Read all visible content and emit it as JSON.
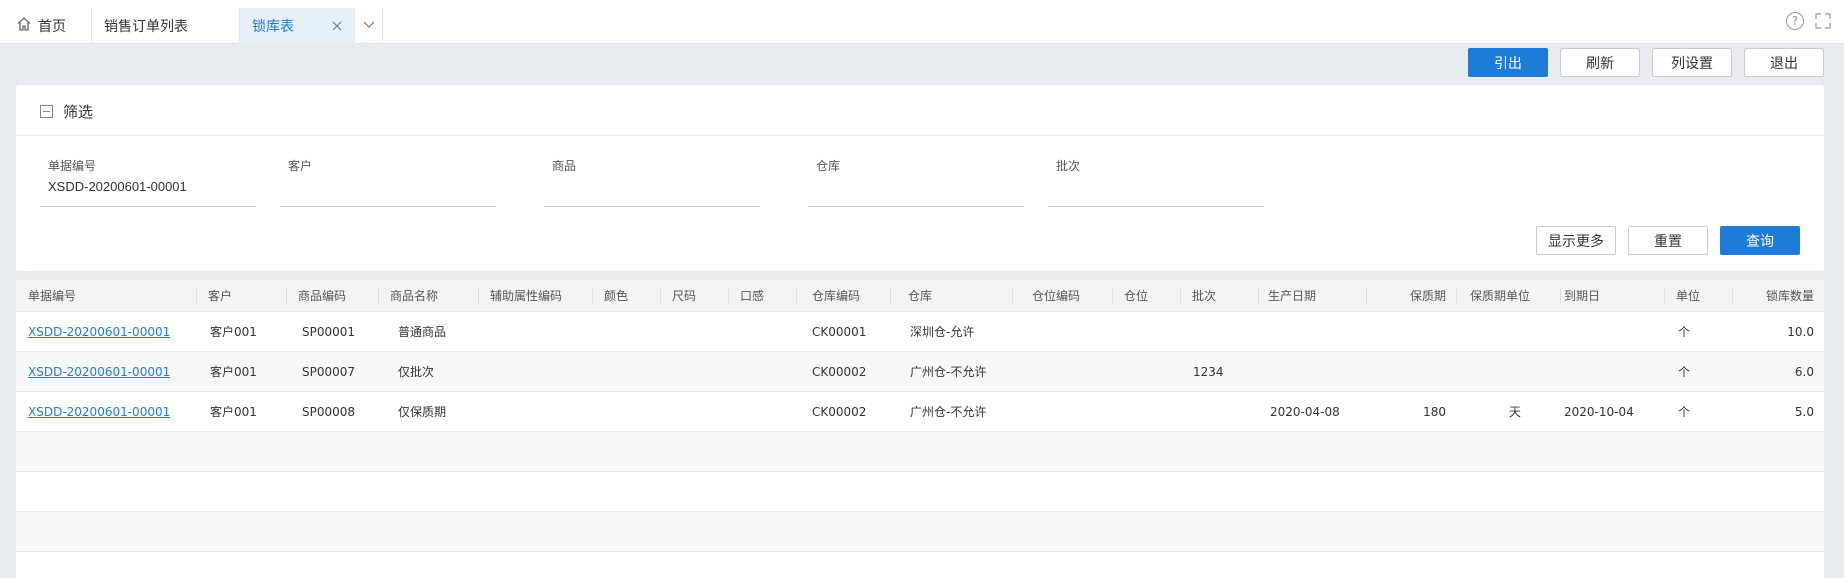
{
  "tabs": {
    "home": "首页",
    "sales_order_list": "销售订单列表",
    "lock_table": "锁库表"
  },
  "toolbar": {
    "export": "引出",
    "refresh": "刷新",
    "column_settings": "列设置",
    "exit": "退出"
  },
  "filter": {
    "title": "筛选",
    "fields": [
      {
        "label": "单据编号",
        "value": "XSDD-20200601-00001"
      },
      {
        "label": "客户",
        "value": ""
      },
      {
        "label": "商品",
        "value": ""
      },
      {
        "label": "仓库",
        "value": ""
      },
      {
        "label": "批次",
        "value": ""
      }
    ],
    "show_more": "显示更多",
    "reset": "重置",
    "query": "查询"
  },
  "table": {
    "headers": [
      "单据编号",
      "客户",
      "商品编码",
      "商品名称",
      "辅助属性编码",
      "颜色",
      "尺码",
      "口感",
      "仓库编码",
      "仓库",
      "仓位编码",
      "仓位",
      "批次",
      "生产日期",
      "保质期",
      "保质期单位",
      "到期日",
      "单位",
      "锁库数量"
    ],
    "rows": [
      {
        "doc_no": "XSDD-20200601-00001",
        "customer": "客户001",
        "sku": "SP00001",
        "name": "普通商品",
        "aux": "",
        "color": "",
        "size": "",
        "taste": "",
        "wh_code": "CK00001",
        "wh": "深圳仓-允许",
        "loc_code": "",
        "loc": "",
        "batch": "",
        "mfg_date": "",
        "shelf_life": "",
        "shelf_unit": "",
        "expiry": "",
        "unit": "个",
        "qty": "10.0"
      },
      {
        "doc_no": "XSDD-20200601-00001",
        "customer": "客户001",
        "sku": "SP00007",
        "name": "仅批次",
        "aux": "",
        "color": "",
        "size": "",
        "taste": "",
        "wh_code": "CK00002",
        "wh": "广州仓-不允许",
        "loc_code": "",
        "loc": "",
        "batch": "1234",
        "mfg_date": "",
        "shelf_life": "",
        "shelf_unit": "",
        "expiry": "",
        "unit": "个",
        "qty": "6.0"
      },
      {
        "doc_no": "XSDD-20200601-00001",
        "customer": "客户001",
        "sku": "SP00008",
        "name": "仅保质期",
        "aux": "",
        "color": "",
        "size": "",
        "taste": "",
        "wh_code": "CK00002",
        "wh": "广州仓-不允许",
        "loc_code": "",
        "loc": "",
        "batch": "",
        "mfg_date": "2020-04-08",
        "shelf_life": "180",
        "shelf_unit": "天",
        "expiry": "2020-10-04",
        "unit": "个",
        "qty": "5.0"
      }
    ]
  },
  "icons": {
    "home": "home-icon",
    "close": "close-icon",
    "more": "chevron-down-icon",
    "help": "help-icon",
    "fullscreen": "fullscreen-icon",
    "collapse": "collapse-icon"
  },
  "colors": {
    "primary": "#1f7bd8",
    "background": "#e8ebef"
  }
}
